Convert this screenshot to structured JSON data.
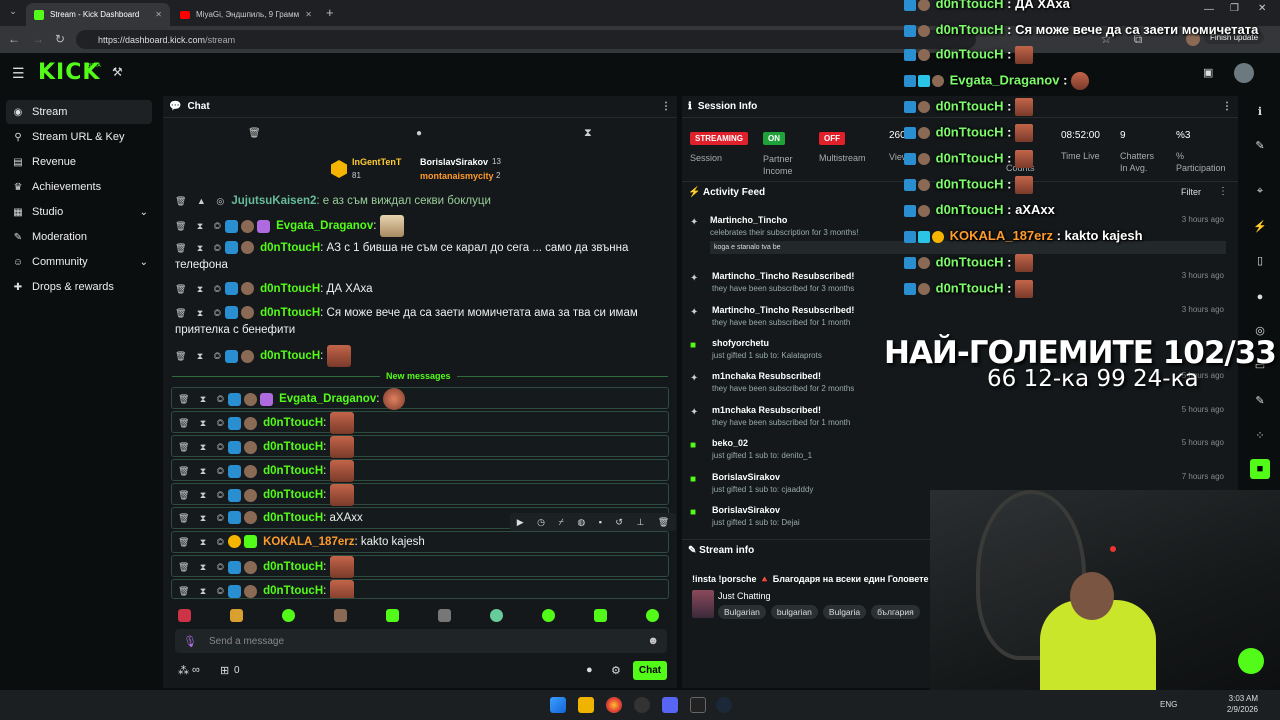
{
  "browser": {
    "tabs": [
      {
        "title": "Stream - Kick Dashboard",
        "active": true
      },
      {
        "title": "MiyaGi, Эндшпиль, 9 Грамм",
        "active": false
      }
    ],
    "url_domain": "https://dashboard.kick.com",
    "url_path": "/stream",
    "update_button": "Finish update"
  },
  "brand": {
    "logo": "KICK",
    "beta": "BETA",
    "accent": "#53fc18"
  },
  "sidebar": {
    "items": [
      {
        "label": "Stream",
        "icon": "broadcast-icon",
        "active": true
      },
      {
        "label": "Stream URL & Key",
        "icon": "key-icon"
      },
      {
        "label": "Revenue",
        "icon": "revenue-icon"
      },
      {
        "label": "Achievements",
        "icon": "trophy-icon"
      },
      {
        "label": "Studio",
        "icon": "studio-icon",
        "expandable": true
      },
      {
        "label": "Moderation",
        "icon": "wrench-icon"
      },
      {
        "label": "Community",
        "icon": "community-icon",
        "expandable": true
      },
      {
        "label": "Drops & rewards",
        "icon": "gift-icon"
      }
    ]
  },
  "chat": {
    "title": "Chat",
    "pinned_top": {
      "user": "InGentTenT",
      "count": "81"
    },
    "leaders": [
      {
        "user": "BorislavSirakov",
        "count": "13"
      },
      {
        "user": "montanaismycity",
        "count": "2"
      }
    ],
    "messages": [
      {
        "user": "JujutsuKaisen2",
        "text": "е аз съм виждал секви боклуци",
        "color": "#53fc18"
      },
      {
        "user": "Evgata_Draganov",
        "text": "",
        "color": "#53fc18"
      },
      {
        "user": "d0nTtoucH",
        "text": "АЗ с 1 бивша не съм се карал до сега ... само да звънна телефона"
      },
      {
        "user": "d0nTtoucH",
        "text": "ДА ХАха"
      },
      {
        "user": "d0nTtoucH",
        "text": "Ся може вече да са заети момичетата ама за тва си имам приятелка с бенефити"
      },
      {
        "user": "d0nTtoucH",
        "text": ""
      }
    ],
    "new_messages_label": "New messages",
    "new_messages": [
      {
        "user": "Evgata_Draganov",
        "text": ""
      },
      {
        "user": "d0nTtoucH",
        "text": ""
      },
      {
        "user": "d0nTtoucH",
        "text": ""
      },
      {
        "user": "d0nTtoucH",
        "text": ""
      },
      {
        "user": "d0nTtoucH",
        "text": ""
      },
      {
        "user": "d0nTtoucH",
        "text": "aXAxx"
      },
      {
        "user": "KOKALA_187erz",
        "text": "kakto kajesh",
        "color": "#ff9a2b"
      },
      {
        "user": "d0nTtoucH",
        "text": ""
      },
      {
        "user": "d0nTtoucH",
        "text": ""
      }
    ],
    "input_placeholder": "Send a message",
    "points_label": "∞",
    "counter": "0",
    "send_label": "Chat"
  },
  "session": {
    "title": "Session Info",
    "status": [
      {
        "badge": "STREAMING",
        "label": "Session",
        "color": "#e0202b"
      },
      {
        "badge": "ON",
        "label": "Partner Income",
        "color": "#1fa23a"
      },
      {
        "badge": "OFF",
        "label": "Multistream",
        "color": "#e0202b"
      }
    ],
    "viewers_value": "260",
    "viewers_label": "View",
    "counts_label": "Counts",
    "time_value": "08:52:00",
    "time_label": "Time Live",
    "chatters_value": "9",
    "chatters_label": "Chatters In Avg.",
    "participation_value": "%3",
    "participation_label": "% Participation"
  },
  "activity": {
    "title": "Activity Feed",
    "filter": "Filter",
    "items": [
      {
        "who": "Martincho_Tincho",
        "sub": "celebrates their subscription for 3 months!",
        "time": "3 hours ago",
        "note": "koga e stanalo tva be"
      },
      {
        "who": "Martincho_Tincho Resubscribed!",
        "sub": "they have been subscribed for 3 months",
        "time": "3 hours ago"
      },
      {
        "who": "Martincho_Tincho Resubscribed!",
        "sub": "they have been subscribed for 1 month",
        "time": "3 hours ago"
      },
      {
        "who": "shofyorchetu",
        "sub": "just gifted 1 sub to: Kalataprots",
        "time": "",
        "gift": true
      },
      {
        "who": "m1nchaka Resubscribed!",
        "sub": "they have been subscribed for 2 months",
        "time": "5 hours ago"
      },
      {
        "who": "m1nchaka Resubscribed!",
        "sub": "they have been subscribed for 1 month",
        "time": "5 hours ago"
      },
      {
        "who": "beko_02",
        "sub": "just gifted 1 sub to: denito_1",
        "time": "5 hours ago",
        "gift": true
      },
      {
        "who": "BorislavSirakov",
        "sub": "just gifted 1 sub to: cjaadddy",
        "time": "7 hours ago",
        "gift": true
      },
      {
        "who": "BorislavSirakov",
        "sub": "just gifted 1 sub to: Dejai",
        "time": "",
        "gift": true
      }
    ]
  },
  "stream_info": {
    "title": "Stream info",
    "stream_title": "!insta !porsche 🔺 Благодаря на всеки един Головете с",
    "category": "Just Chatting",
    "tags": [
      "Bulgarian",
      "bulgarian",
      "Bulgaria",
      "българия"
    ]
  },
  "overlay": {
    "lines": [
      {
        "user": "d0nTtoucH",
        "text": "ДА ХАха"
      },
      {
        "user": "d0nTtoucH",
        "text": "Ся може вече да са заети момичетата"
      },
      {
        "user": "d0nTtoucH",
        "text": ""
      },
      {
        "user": "Evgata_Draganov",
        "text": ""
      },
      {
        "user": "d0nTtoucH",
        "text": ""
      },
      {
        "user": "d0nTtoucH",
        "text": ""
      },
      {
        "user": "d0nTtoucH",
        "text": ""
      },
      {
        "user": "d0nTtoucH",
        "text": ""
      },
      {
        "user": "d0nTtoucH",
        "text": "aXAxx"
      },
      {
        "user": "KOKALA_187erz",
        "text": "kakto kajesh"
      },
      {
        "user": "d0nTtoucH",
        "text": ""
      },
      {
        "user": "d0nTtoucH",
        "text": ""
      }
    ],
    "big_title": "НАЙ-ГОЛЕМИТЕ 102/33",
    "sub_title": "66 12-ка 99 24-ка"
  },
  "taskbar": {
    "lang": "ENG",
    "time": "3:03 AM",
    "date": "2/9/2026"
  }
}
